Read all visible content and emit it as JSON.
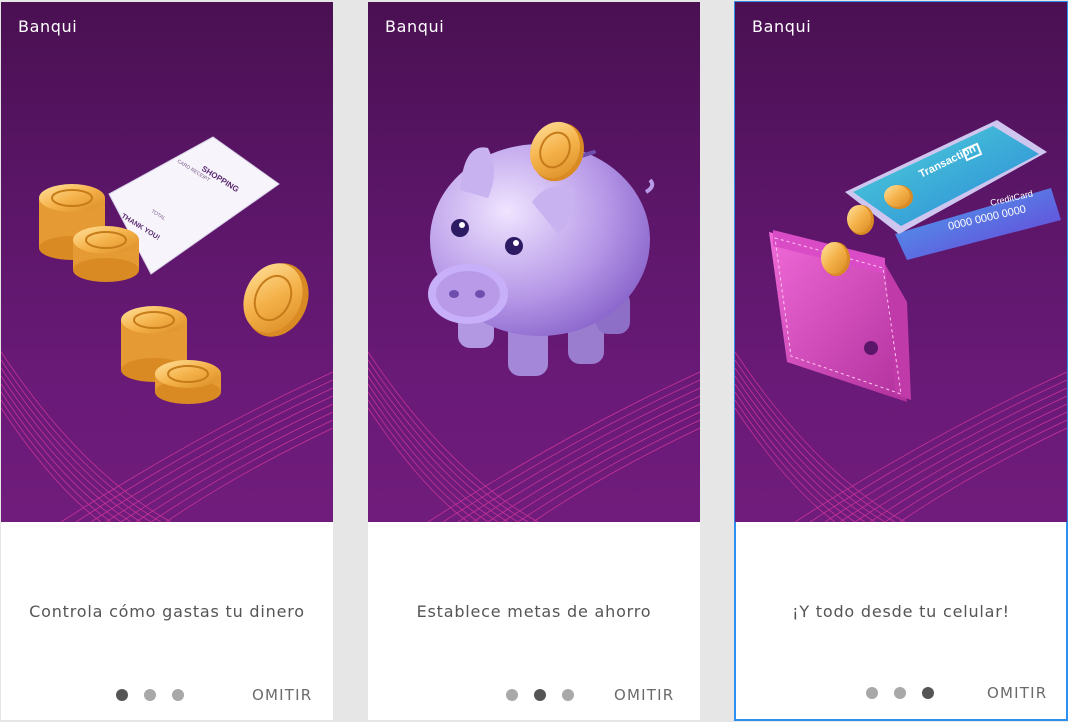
{
  "brand": "Banqui",
  "screens": [
    {
      "caption": "Controla cómo gastas tu dinero",
      "active_dot": 1,
      "skip_label": "OMITIR",
      "illustration": "coins-and-receipt"
    },
    {
      "caption": "Establece metas de ahorro",
      "active_dot": 2,
      "skip_label": "OMITIR",
      "illustration": "piggy-bank"
    },
    {
      "caption": "¡Y todo desde tu celular!",
      "active_dot": 3,
      "skip_label": "OMITIR",
      "illustration": "phone-wallet-card"
    }
  ],
  "receipt": {
    "heading": "SHOPPING",
    "subheading": "CARD RECEIPT",
    "total_label": "TOTAL",
    "thanks": "THANK YOU!"
  },
  "phone": {
    "screen_label": "Transaction",
    "card_label": "CreditCard",
    "card_number": "0000 0000 0000"
  },
  "colors": {
    "hero_top": "#4a1052",
    "hero_bottom": "#701c7c",
    "wave": "#e23aa0",
    "dot_active": "#555555",
    "dot_inactive": "#a8a8a8",
    "selection_outline": "#2e8ff0"
  }
}
